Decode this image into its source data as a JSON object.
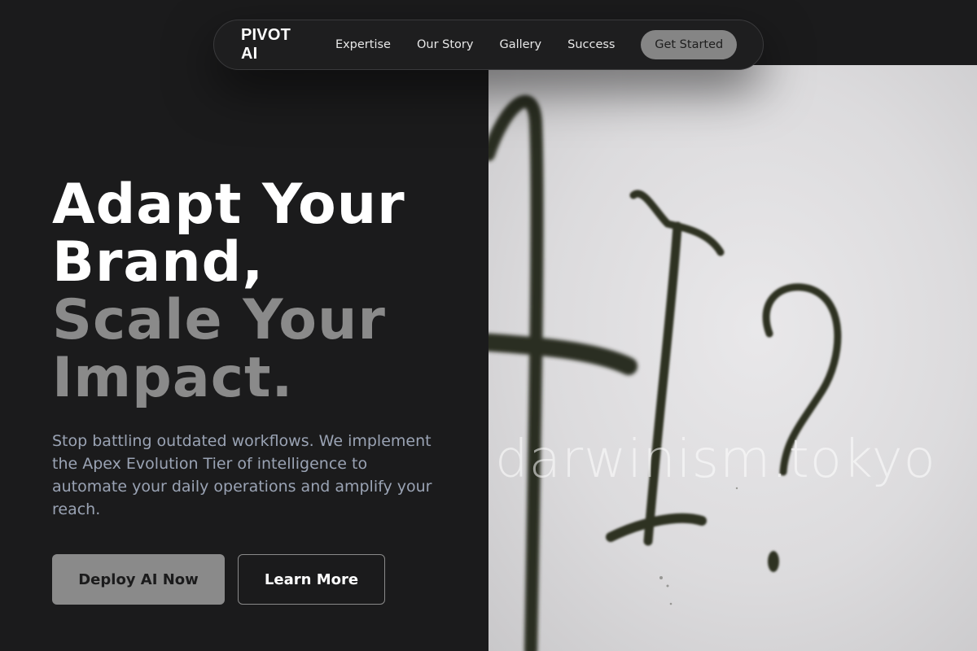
{
  "nav": {
    "brand": "PIVOT AI",
    "links": [
      "Expertise",
      "Our Story",
      "Gallery",
      "Success"
    ],
    "cta": "Get Started"
  },
  "hero": {
    "headline_primary": [
      "Adapt Your",
      "Brand,"
    ],
    "headline_muted": [
      "Scale Your",
      "Impact."
    ],
    "subtext": "Stop battling outdated workflows. We implement the Apex Evolution Tier of intelligence to automate your daily operations and amplify your reach.",
    "primary_button": "Deploy AI Now",
    "secondary_button": "Learn More"
  },
  "image": {
    "watermark": "darwinism.tokyo"
  },
  "colors": {
    "background": "#1b1b1c",
    "accent_gray": "#8a8a8a",
    "subtext": "#9aa3b4"
  }
}
